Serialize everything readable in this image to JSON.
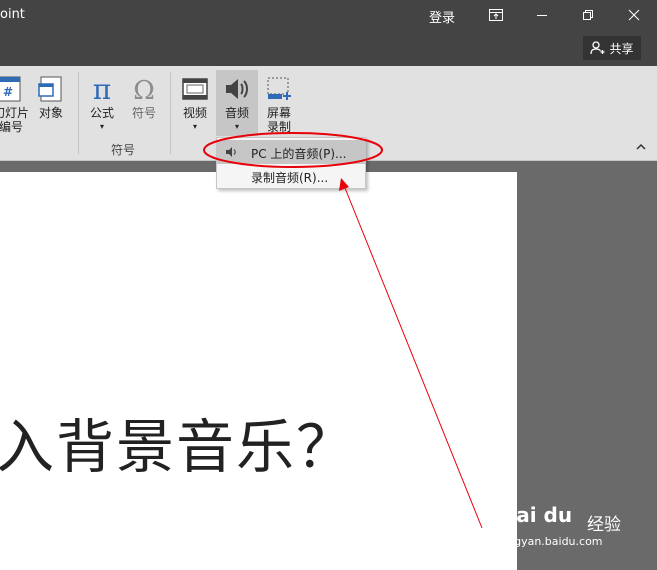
{
  "titlebar": {
    "app_title": "oint",
    "login": "登录",
    "ribbon_display_icon": "ribbon-display-icon",
    "minimize_icon": "minimize-icon",
    "restore_icon": "restore-icon",
    "close_icon": "close-icon"
  },
  "share": {
    "label": "共享",
    "icon": "person-add-icon"
  },
  "ribbon": {
    "slide_number_label_1": "幻灯片",
    "slide_number_label_2": "编号",
    "object_label": "对象",
    "equation_label": "公式",
    "symbol_label": "符号",
    "symbols_group_label": "符号",
    "video_label": "视频",
    "audio_label": "音频",
    "screen_recording_label_1": "屏幕",
    "screen_recording_label_2": "录制"
  },
  "dropdown": {
    "items": [
      {
        "label": "PC 上的音频(P)..."
      },
      {
        "label": "录制音频(R)..."
      }
    ]
  },
  "slide": {
    "text": "入背景音乐？"
  },
  "watermark": {
    "logo": "Bai du",
    "cn": "经验",
    "url": "jingyan.baidu.com"
  },
  "colors": {
    "annotation": "#e8000a",
    "titlebar": "#444444",
    "ribbon": "#e1e1e1"
  }
}
